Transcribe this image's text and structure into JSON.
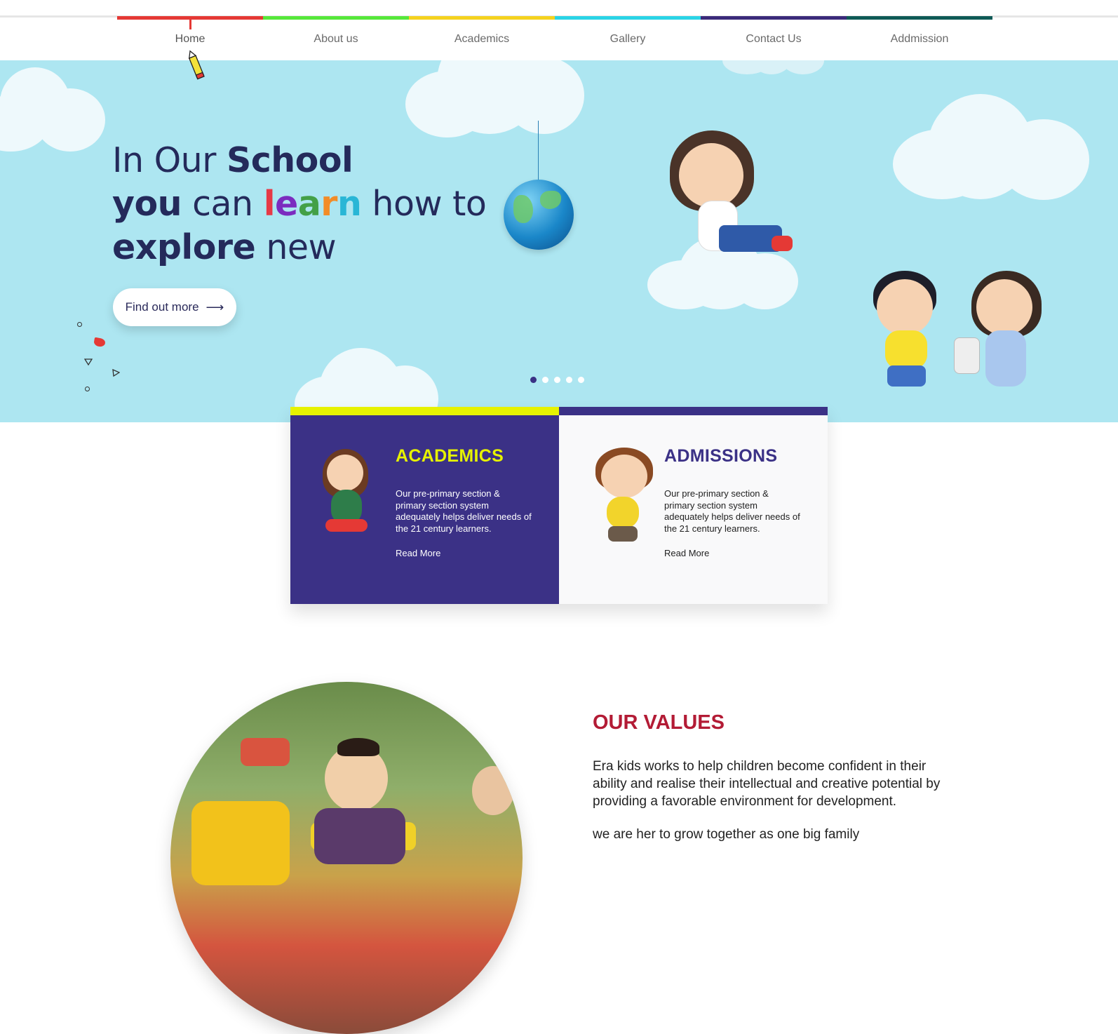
{
  "nav": {
    "strip_colors": [
      "#e53935",
      "#56e83a",
      "#f5d21e",
      "#2ad4e6",
      "#3b2a7a",
      "#0f5a56"
    ],
    "items": [
      {
        "label": "Home",
        "active": true
      },
      {
        "label": "About us"
      },
      {
        "label": "Academics"
      },
      {
        "label": "Gallery"
      },
      {
        "label": "Contact Us"
      },
      {
        "label": "Addmission"
      }
    ]
  },
  "hero": {
    "line1_a": "In Our ",
    "line1_b": "School",
    "line2_a": "you",
    "line2_b": " can ",
    "learn": [
      "l",
      "e",
      "a",
      "r",
      "n"
    ],
    "line2_c": " how to",
    "line3_a": "explore",
    "line3_b": " new",
    "cta_label": "Find out more",
    "cta_arrow": "⟶",
    "slider_count": 5,
    "slider_active": 1
  },
  "cards": {
    "academics": {
      "title": "ACADEMICS",
      "text": "Our pre-primary section & primary section system adequately helps deliver needs of the 21 century learners.",
      "link": "Read More"
    },
    "admissions": {
      "title": "ADMISSIONS",
      "text": "Our pre-primary section & primary section system adequately helps deliver needs of the 21 century learners.",
      "link": "Read More"
    }
  },
  "values": {
    "title": "OUR VALUES",
    "text": "Era kids works to help children become confident in their ability and realise their intellectual and creative potential by providing a favorable environment for development.",
    "text2": "we are her to grow together as one big family"
  }
}
